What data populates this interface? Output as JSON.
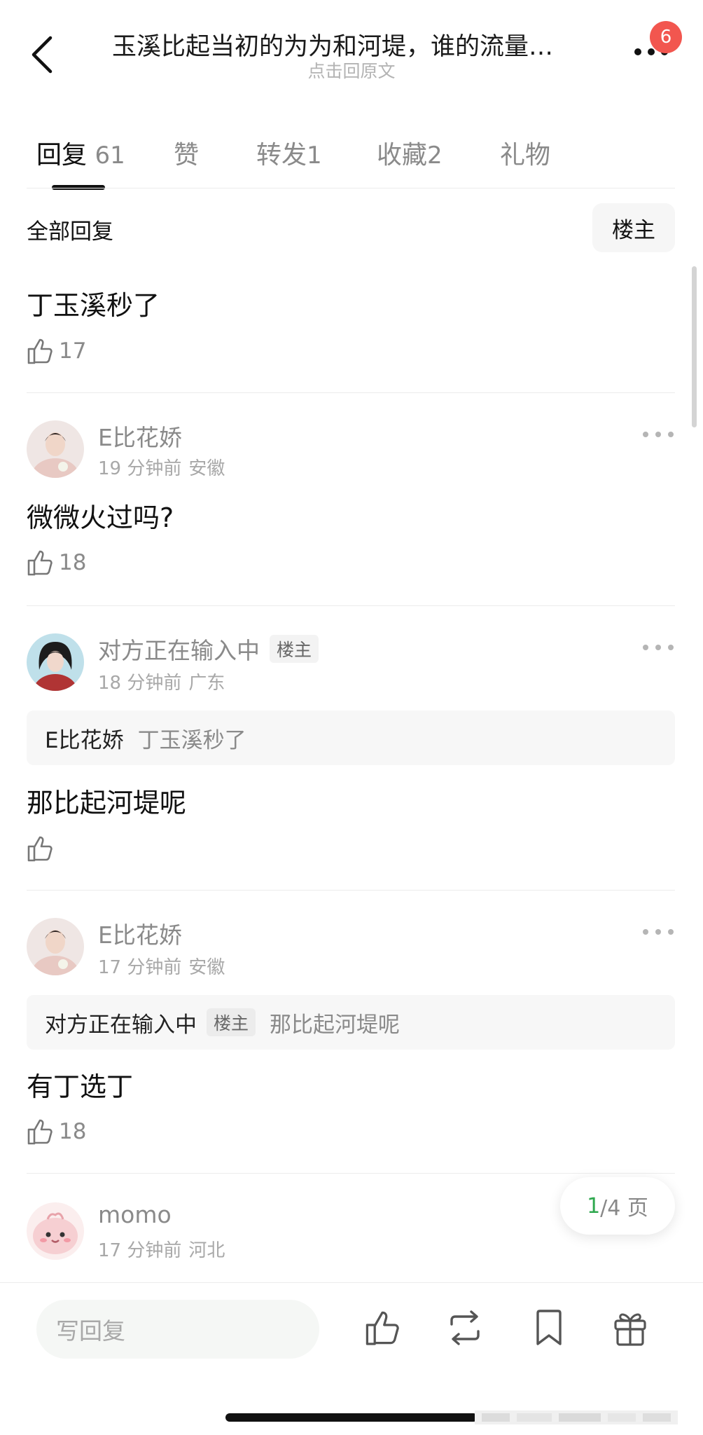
{
  "header": {
    "title": "玉溪比起当初的为为和河堤，谁的流量…",
    "subtitle": "点击回原文",
    "badge_count": "6"
  },
  "tabs": [
    {
      "label": "回复",
      "count": "61",
      "active": true
    },
    {
      "label": "赞",
      "count": "",
      "active": false
    },
    {
      "label": "转发",
      "count": "1",
      "active": false
    },
    {
      "label": "收藏",
      "count": "2",
      "active": false
    },
    {
      "label": "礼物",
      "count": "",
      "active": false
    }
  ],
  "filter": {
    "label": "全部回复",
    "owner_button": "楼主"
  },
  "comments": [
    {
      "text": "丁玉溪秒了",
      "likes": "17"
    },
    {
      "author": "E比花娇",
      "time": "19 分钟前",
      "location": "安徽",
      "text": "微微火过吗?",
      "likes": "18"
    },
    {
      "author": "对方正在输入中",
      "owner_tag": "楼主",
      "time": "18 分钟前",
      "location": "广东",
      "quote": {
        "author": "E比花娇",
        "text": "丁玉溪秒了"
      },
      "text": "那比起河堤呢",
      "likes": ""
    },
    {
      "author": "E比花娇",
      "time": "17 分钟前",
      "location": "安徽",
      "quote": {
        "author": "对方正在输入中",
        "tag": "楼主",
        "text": "那比起河堤呢"
      },
      "text": "有丁选丁",
      "likes": "18"
    },
    {
      "author": "momo",
      "time": "17 分钟前",
      "location": "河北"
    }
  ],
  "pager": {
    "current": "1",
    "total": "/4 页"
  },
  "bottom_bar": {
    "reply_placeholder": "写回复",
    "icons": [
      "thumbs-up-icon",
      "repost-icon",
      "bookmark-icon",
      "gift-icon"
    ]
  },
  "colors": {
    "accent_green": "#2fa84f",
    "badge_red": "#f2564f"
  }
}
